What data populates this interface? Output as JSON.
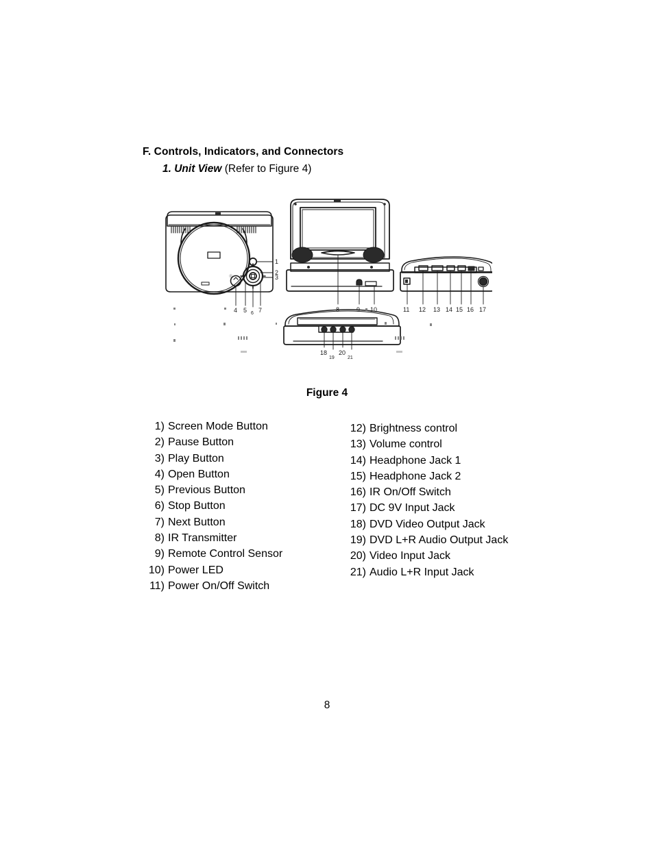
{
  "document": {
    "page_number": "8"
  },
  "headings": {
    "section": "F. Controls, Indicators, and Connectors",
    "subsection_em": "1. Unit View",
    "subsection_rest": " (Refer to Figure 4)"
  },
  "figure": {
    "caption": "Figure 4",
    "callouts": {
      "top_view": [
        "1",
        "2",
        "3",
        "4",
        "5",
        "6",
        "7"
      ],
      "front_view": [
        "8",
        "9",
        "10"
      ],
      "side_view": [
        "11",
        "12",
        "13",
        "14",
        "15",
        "16",
        "17"
      ],
      "rear_view": [
        "18",
        "19",
        "20",
        "21"
      ]
    }
  },
  "legend": {
    "left_column": [
      {
        "num": "1)",
        "label": "Screen Mode Button"
      },
      {
        "num": "2)",
        "label": "Pause Button"
      },
      {
        "num": "3)",
        "label": "Play Button"
      },
      {
        "num": "4)",
        "label": "Open Button"
      },
      {
        "num": "5)",
        "label": "Previous Button"
      },
      {
        "num": "6)",
        "label": "Stop Button"
      },
      {
        "num": "7)",
        "label": "Next Button"
      },
      {
        "num": "8)",
        "label": "IR Transmitter"
      },
      {
        "num": "9)",
        "label": "Remote Control Sensor"
      },
      {
        "num": "10)",
        "label": "Power LED"
      },
      {
        "num": "11)",
        "label": "Power On/Off Switch"
      }
    ],
    "right_column": [
      {
        "num": "12)",
        "label": "Brightness control"
      },
      {
        "num": "13)",
        "label": "Volume control"
      },
      {
        "num": "14)",
        "label": "Headphone Jack 1"
      },
      {
        "num": "15)",
        "label": "Headphone Jack 2"
      },
      {
        "num": "16)",
        "label": "IR On/Off Switch"
      },
      {
        "num": "17)",
        "label": "DC 9V Input Jack"
      },
      {
        "num": "18)",
        "label": "DVD Video Output Jack"
      },
      {
        "num": "19)",
        "label": "DVD L+R Audio Output Jack"
      },
      {
        "num": "20)",
        "label": "Video Input Jack"
      },
      {
        "num": "21)",
        "label": "Audio L+R Input Jack"
      }
    ]
  },
  "colors": {
    "ink": "#000000",
    "paper": "#ffffff",
    "line": "#1a1a1a",
    "speaker_fill": "#2a2a2a"
  }
}
